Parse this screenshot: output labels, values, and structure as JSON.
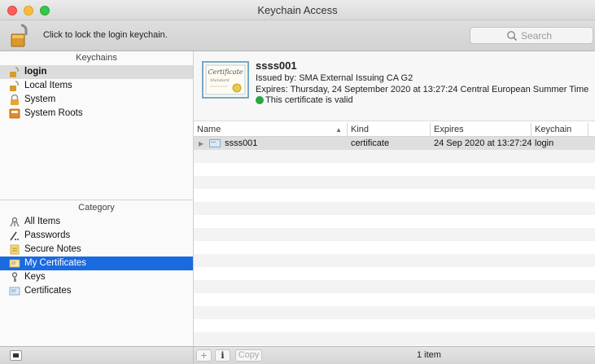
{
  "window": {
    "title": "Keychain Access"
  },
  "toolbar": {
    "lock_text": "Click to lock the login keychain.",
    "search_placeholder": "Search"
  },
  "sidebar": {
    "keychains_header": "Keychains",
    "keychains": [
      {
        "label": "login",
        "icon": "unlocked-padlock-icon",
        "selected": true
      },
      {
        "label": "Local Items",
        "icon": "unlocked-padlock-icon",
        "selected": false
      },
      {
        "label": "System",
        "icon": "locked-padlock-icon",
        "selected": false
      },
      {
        "label": "System Roots",
        "icon": "cabinet-icon",
        "selected": false
      }
    ],
    "category_header": "Category",
    "categories": [
      {
        "label": "All Items",
        "icon": "all-items-icon",
        "selected": false
      },
      {
        "label": "Passwords",
        "icon": "password-icon",
        "selected": false
      },
      {
        "label": "Secure Notes",
        "icon": "note-icon",
        "selected": false
      },
      {
        "label": "My Certificates",
        "icon": "certificate-icon",
        "selected": true
      },
      {
        "label": "Keys",
        "icon": "key-icon",
        "selected": false
      },
      {
        "label": "Certificates",
        "icon": "certificate-icon",
        "selected": false
      }
    ]
  },
  "detail": {
    "name": "ssss001",
    "issued_by": "Issued by: SMA External Issuing CA G2",
    "expires": "Expires: Thursday, 24 September 2020 at 13:27:24 Central European Summer Time",
    "validity": "This certificate is valid",
    "cert_image_text_1": "Certificate",
    "cert_image_text_2": "Standard"
  },
  "table": {
    "columns": {
      "name": "Name",
      "kind": "Kind",
      "expires": "Expires",
      "keychain": "Keychain"
    },
    "rows": [
      {
        "name": "ssss001",
        "kind": "certificate",
        "expires": "24 Sep 2020 at 13:27:24",
        "keychain": "login"
      }
    ]
  },
  "bottombar": {
    "add_label": "+",
    "info_label": "i",
    "copy_label": "Copy",
    "item_count": "1 item"
  },
  "colors": {
    "selection_blue": "#1a6ae0",
    "valid_green": "#28a745",
    "lock_gold": "#d99a2b"
  }
}
